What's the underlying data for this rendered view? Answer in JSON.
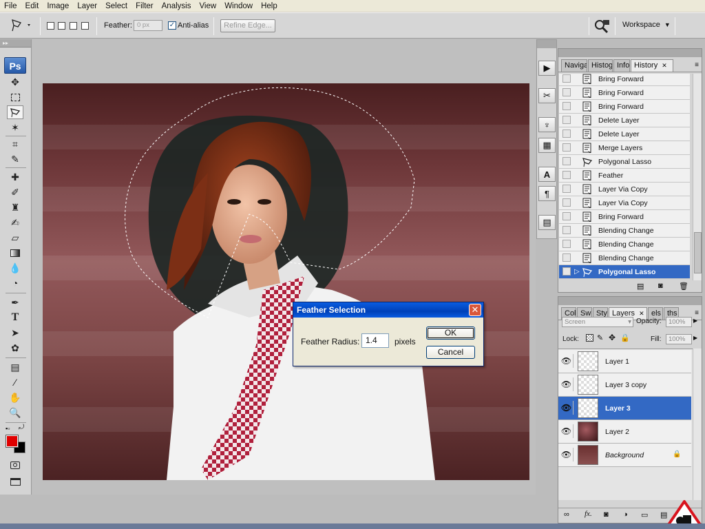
{
  "menu": [
    "File",
    "Edit",
    "Image",
    "Layer",
    "Select",
    "Filter",
    "Analysis",
    "View",
    "Window",
    "Help"
  ],
  "options": {
    "feather_label": "Feather:",
    "feather_value": "0 px",
    "antialias_label": "Anti-alias",
    "refine_edge": "Refine Edge...",
    "workspace": "Workspace"
  },
  "toolbox": {
    "logo": "Ps"
  },
  "dialog": {
    "title": "Feather Selection",
    "radius_label": "Feather Radius:",
    "radius_value": "1.4",
    "unit": "pixels",
    "ok": "OK",
    "cancel": "Cancel"
  },
  "history_panel": {
    "tabs": [
      "Naviga",
      "Histogr",
      "Info",
      "History"
    ],
    "active_tab": "History",
    "items": [
      "Bring Forward",
      "Bring Forward",
      "Bring Forward",
      "Delete Layer",
      "Delete Layer",
      "Merge Layers",
      "Polygonal Lasso",
      "Feather",
      "Layer Via Copy",
      "Layer Via Copy",
      "Bring Forward",
      "Blending Change",
      "Blending Change",
      "Blending Change",
      "Polygonal Lasso"
    ],
    "current_index": 14
  },
  "layers_panel": {
    "tabs": [
      "Col",
      "Swi",
      "Sty",
      "Layers",
      "els",
      "ths"
    ],
    "active_tab": "Layers",
    "blend_mode": "Screen",
    "opacity_label": "Opacity:",
    "opacity_value": "100%",
    "lock_label": "Lock:",
    "fill_label": "Fill:",
    "fill_value": "100%",
    "layers": [
      "Layer 1",
      "Layer 3 copy",
      "Layer 3",
      "Layer 2",
      "Background"
    ],
    "current_index": 2
  },
  "colors": {
    "foreground": "#e00000",
    "background": "#000000",
    "selection": "#3369c4",
    "xp_title": "#0a5ce0"
  }
}
